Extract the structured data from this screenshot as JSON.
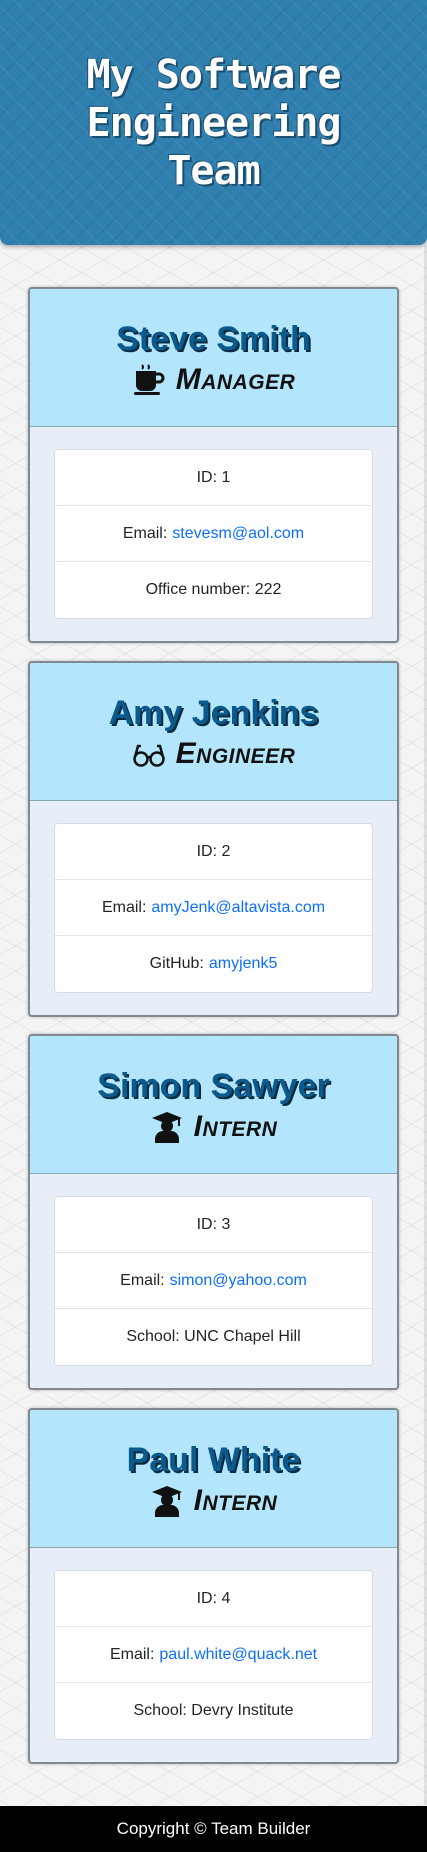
{
  "header": {
    "title": "My Software Engineering Team"
  },
  "team": [
    {
      "name": "Steve Smith",
      "role": "Manager",
      "icon": "coffee-icon",
      "id_label": "ID:",
      "id": "1",
      "email_label": "Email:",
      "email": "stevesm@aol.com",
      "extra_label": "Office number:",
      "extra": "222"
    },
    {
      "name": "Amy Jenkins",
      "role": "Engineer",
      "icon": "glasses-icon",
      "id_label": "ID:",
      "id": "2",
      "email_label": "Email:",
      "email": "amyJenk@altavista.com",
      "extra_label": "GitHub:",
      "extra": "amyjenk5"
    },
    {
      "name": "Simon Sawyer",
      "role": "Intern",
      "icon": "graduate-icon",
      "id_label": "ID:",
      "id": "3",
      "email_label": "Email:",
      "email": "simon@yahoo.com",
      "extra_label": "School:",
      "extra": "UNC Chapel Hill"
    },
    {
      "name": "Paul White",
      "role": "Intern",
      "icon": "graduate-icon",
      "id_label": "ID:",
      "id": "4",
      "email_label": "Email:",
      "email": "paul.white@quack.net",
      "extra_label": "School:",
      "extra": "Devry Institute"
    }
  ],
  "footer": {
    "text": "Copyright © Team Builder"
  },
  "colors": {
    "header_bg": "#2f7faf",
    "card_head_bg": "#b3e5fc",
    "link": "#0d6efd",
    "footer_bg": "#000000"
  }
}
